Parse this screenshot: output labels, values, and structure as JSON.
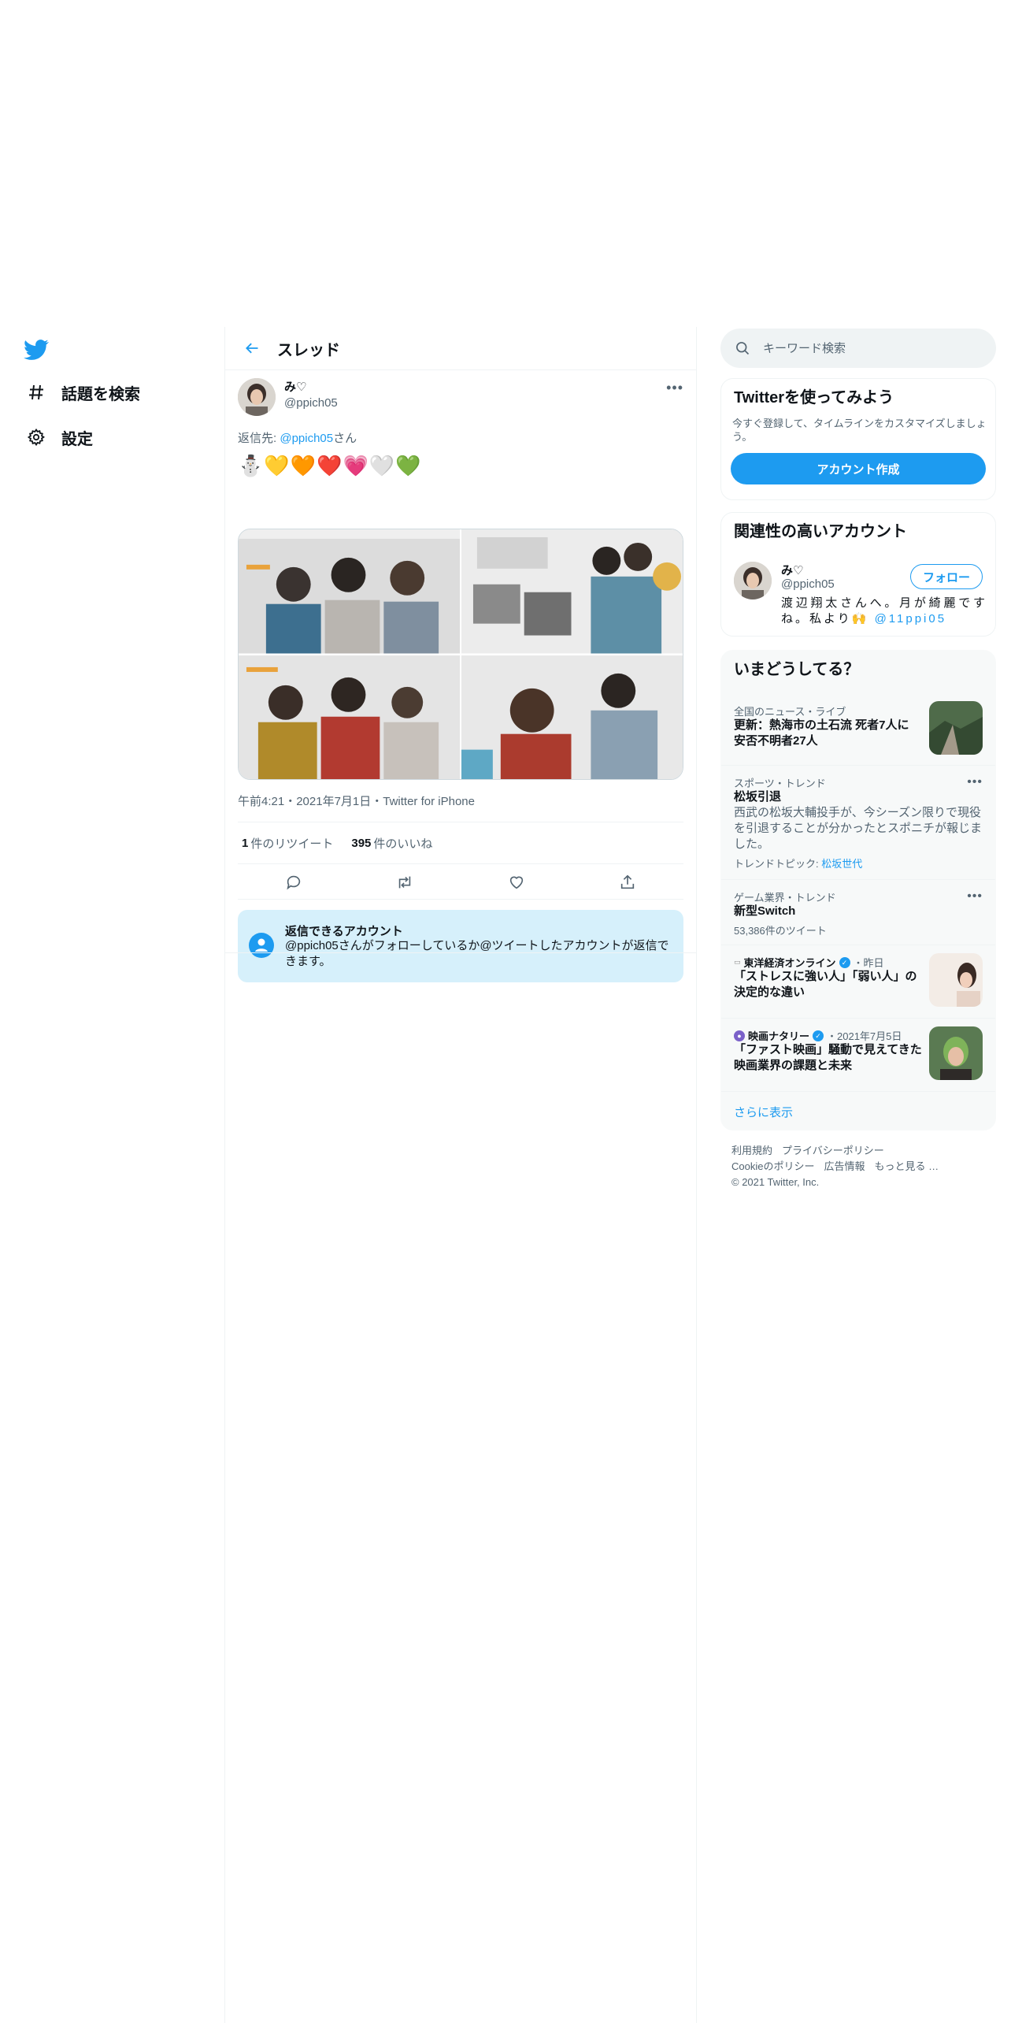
{
  "nav": {
    "logo": "twitter-bird-icon",
    "items": [
      {
        "label": "話題を検索",
        "icon": "hashtag-icon"
      },
      {
        "label": "設定",
        "icon": "gear-icon"
      }
    ]
  },
  "thread": {
    "title": "スレッド",
    "tweet": {
      "name": "み♡",
      "handle": "@ppich05",
      "reply_prefix": "返信先: ",
      "reply_handle": "@ppich05",
      "reply_suffix": "さん",
      "text": "⛄💛🧡❤️💗🤍💚",
      "meta": "午前4:21・2021年7月1日・Twitter for iPhone",
      "retweet_count": "1",
      "retweet_label": "件のリツイート",
      "like_count": "395",
      "like_label": "件のいいね"
    },
    "reply_box": {
      "title": "返信できるアカウント",
      "text": "@ppich05さんがフォローしているか@ツイートしたアカウントが返信できます。"
    }
  },
  "search": {
    "placeholder": "キーワード検索"
  },
  "signup": {
    "title": "Twitterを使ってみよう",
    "subtitle": "今すぐ登録して、タイムラインをカスタマイズしましょう。",
    "button": "アカウント作成"
  },
  "related": {
    "title": "関連性の高いアカウント",
    "name": "み♡",
    "handle": "@ppich05",
    "follow": "フォロー",
    "bio": "渡辺翔太さんへ。月が綺麗ですね。私より🙌",
    "bio_link": "@11ppi05"
  },
  "trends": {
    "title": "いまどうしてる？",
    "items": [
      {
        "context": "全国のニュース・ライブ",
        "title": "更新：熱海市の土石流 死者7人に 安否不明者27人"
      },
      {
        "context": "スポーツ・トレンド",
        "title": "松坂引退",
        "desc": "西武の松坂大輔投手が、今シーズン限りで現役を引退することが分かったとスポニチが報じました。",
        "topic_prefix": "トレンドトピック: ",
        "topic": "松坂世代"
      },
      {
        "context": "ゲーム業界・トレンド",
        "title": "新型Switch",
        "count": "53,386件のツイート"
      },
      {
        "source": "東洋経済オンライン",
        "time": "・昨日",
        "title": "「ストレスに強い人」「弱い人」の決定的な違い"
      },
      {
        "source": "映画ナタリー",
        "time": "・2021年7月5日",
        "title": "「ファスト映画」騒動で見えてきた映画業界の課題と未来"
      }
    ],
    "show_more": "さらに表示"
  },
  "footer": {
    "links": [
      "利用規約",
      "プライバシーポリシー",
      "Cookieのポリシー",
      "広告情報",
      "もっと見る …"
    ],
    "copyright": "© 2021 Twitter, Inc."
  },
  "colors": {
    "accent": "#1d9bf0",
    "reply_box_bg": "#d6f0fb",
    "muted": "#536471"
  }
}
